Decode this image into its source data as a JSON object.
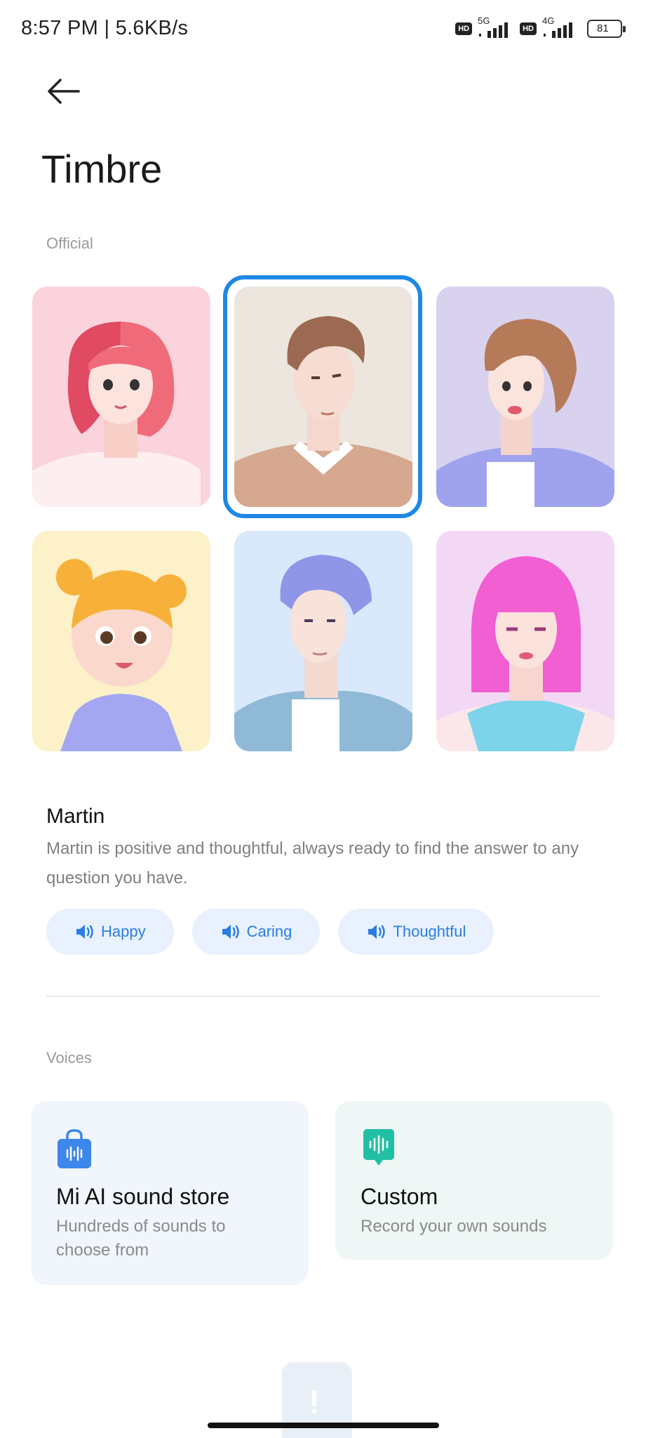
{
  "status_bar": {
    "time_speed": "8:57 PM | 5.6KB/s",
    "hd1": "HD",
    "net1": "5G",
    "hd2": "HD",
    "net2": "4G",
    "battery": "81"
  },
  "page": {
    "title": "Timbre"
  },
  "sections": {
    "official": "Official",
    "voices": "Voices"
  },
  "avatars": [
    {
      "name": "pink-hair-woman",
      "background": "#fbd3dc",
      "selected": false
    },
    {
      "name": "martin",
      "background": "#ece6df",
      "selected": true
    },
    {
      "name": "short-brown-hair-woman",
      "background": "#d9d2ef",
      "selected": false
    },
    {
      "name": "girl-with-buns",
      "background": "#fcf1c9",
      "selected": false
    },
    {
      "name": "blue-hair-man",
      "background": "#d9e8fb",
      "selected": false
    },
    {
      "name": "magenta-hair-woman",
      "background": "#f3d8f6",
      "selected": false
    }
  ],
  "selected_voice": {
    "name": "Martin",
    "description": "Martin is positive and thoughtful, always ready to find the answer to any question you have.",
    "tags": [
      "Happy",
      "Caring",
      "Thoughtful"
    ]
  },
  "voice_options": [
    {
      "title": "Mi AI sound store",
      "subtitle": "Hundreds of sounds to choose from",
      "icon": "shopping-bag-icon"
    },
    {
      "title": "Custom",
      "subtitle": "Record your own sounds",
      "icon": "voice-record-icon"
    }
  ],
  "colors": {
    "accent": "#1e88e5",
    "tag_bg": "#e8f1fd",
    "tag_text": "#2a7de1"
  }
}
